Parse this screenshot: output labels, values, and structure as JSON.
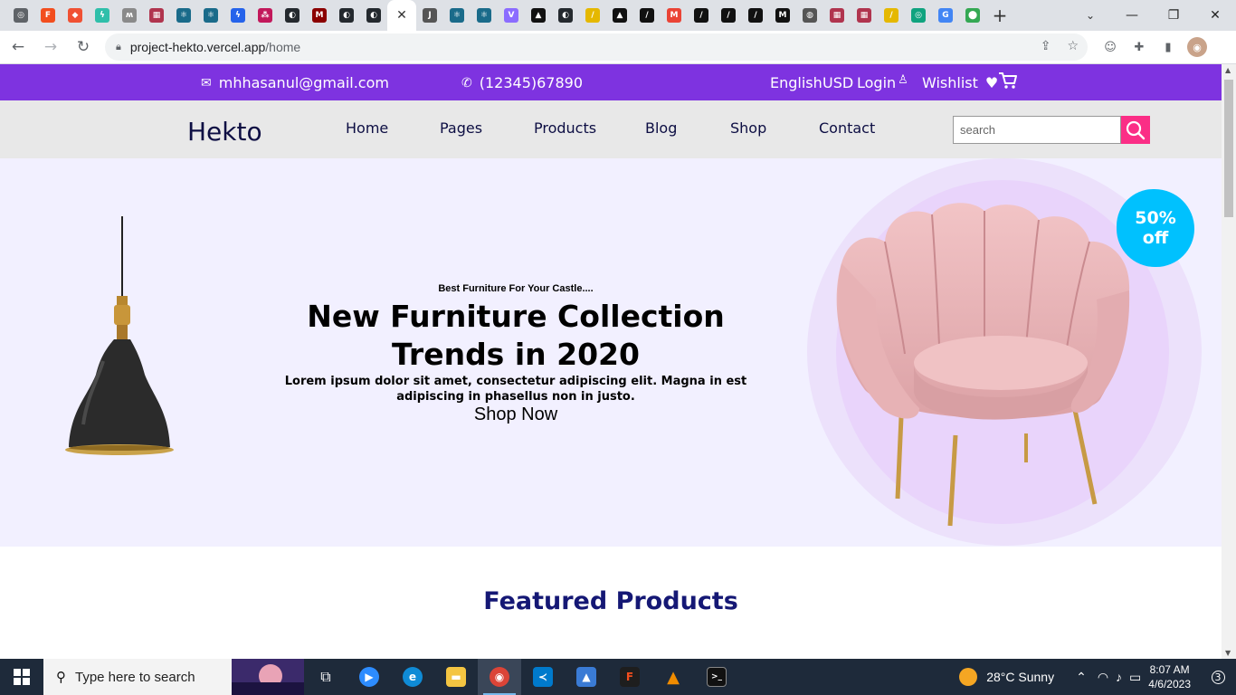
{
  "browser": {
    "tabs": [
      {
        "icon": "chrome-icon",
        "color": "#5f6368",
        "glyph": "◎"
      },
      {
        "icon": "figma-icon",
        "color": "#f24e1e",
        "glyph": "F"
      },
      {
        "icon": "git-icon",
        "color": "#f05133",
        "glyph": "◆"
      },
      {
        "icon": "bolt-icon",
        "color": "#2fbfaa",
        "glyph": "ϟ"
      },
      {
        "icon": "logo-icon",
        "color": "#8a8a8a",
        "glyph": "ʍ"
      },
      {
        "icon": "gift-icon",
        "color": "#b0344e",
        "glyph": "▦"
      },
      {
        "icon": "react-icon",
        "color": "#1a6b8a",
        "glyph": "⚛"
      },
      {
        "icon": "react-icon",
        "color": "#1a6b8a",
        "glyph": "⚛"
      },
      {
        "icon": "bolt-icon",
        "color": "#2563eb",
        "glyph": "ϟ"
      },
      {
        "icon": "dots-icon",
        "color": "#c2185b",
        "glyph": "⁂"
      },
      {
        "icon": "github-icon",
        "color": "#24292e",
        "glyph": "◐"
      },
      {
        "icon": "m-icon",
        "color": "#8b0000",
        "glyph": "M"
      },
      {
        "icon": "github-icon",
        "color": "#24292e",
        "glyph": "◐"
      },
      {
        "icon": "github-icon",
        "color": "#24292e",
        "glyph": "◐"
      }
    ],
    "active_tab_glyph": "✕",
    "tabs_right": [
      {
        "icon": "jadoo-icon",
        "color": "#555555",
        "glyph": "J"
      },
      {
        "icon": "react-icon",
        "color": "#1a6b8a",
        "glyph": "⚛"
      },
      {
        "icon": "react-icon",
        "color": "#1a6b8a",
        "glyph": "⚛"
      },
      {
        "icon": "vite-icon",
        "color": "#8b6cff",
        "glyph": "V"
      },
      {
        "icon": "triangle-icon",
        "color": "#111111",
        "glyph": "▲"
      },
      {
        "icon": "github-icon",
        "color": "#24292e",
        "glyph": "◐"
      },
      {
        "icon": "slash-icon",
        "color": "#e5b800",
        "glyph": "/"
      },
      {
        "icon": "triangle-icon",
        "color": "#111111",
        "glyph": "▲"
      },
      {
        "icon": "code-icon",
        "color": "#111111",
        "glyph": "/"
      },
      {
        "icon": "gmail-icon",
        "color": "#ea4335",
        "glyph": "M"
      },
      {
        "icon": "code-icon",
        "color": "#111111",
        "glyph": "/"
      },
      {
        "icon": "code-icon",
        "color": "#111111",
        "glyph": "/"
      },
      {
        "icon": "code-icon",
        "color": "#111111",
        "glyph": "/"
      },
      {
        "icon": "m-icon",
        "color": "#111111",
        "glyph": "M"
      },
      {
        "icon": "globe-icon",
        "color": "#555555",
        "glyph": "◍"
      },
      {
        "icon": "gift-icon",
        "color": "#b0344e",
        "glyph": "▦"
      },
      {
        "icon": "gift-icon",
        "color": "#b0344e",
        "glyph": "▦"
      },
      {
        "icon": "slash-icon",
        "color": "#e5b800",
        "glyph": "/"
      },
      {
        "icon": "chatgpt-icon",
        "color": "#10a37f",
        "glyph": "◎"
      },
      {
        "icon": "google-icon",
        "color": "#4285f4",
        "glyph": "G"
      },
      {
        "icon": "maps-icon",
        "color": "#34a853",
        "glyph": "⬤"
      }
    ],
    "newtab_glyph": "+",
    "url_host": "project-hekto.vercel.app",
    "url_path": "/home"
  },
  "topbar": {
    "email": "mhhasanul@gmail.com",
    "phone": "(12345)67890",
    "language": "English",
    "currency": "USD",
    "login": "Login",
    "wishlist": "Wishlist"
  },
  "header": {
    "logo": "Hekto",
    "nav": [
      "Home",
      "Pages",
      "Products",
      "Blog",
      "Shop",
      "Contact"
    ],
    "search_placeholder": "search"
  },
  "hero": {
    "tagline": "Best Furniture For Your Castle....",
    "title": "New Furniture Collection Trends in 2020",
    "description": "Lorem ipsum dolor sit amet, consectetur adipiscing elit. Magna in est adipiscing in phasellus non in justo.",
    "cta": "Shop Now",
    "badge_line1": "50%",
    "badge_line2": "off"
  },
  "sections": {
    "featured_title": "Featured Products"
  },
  "taskbar": {
    "search_placeholder": "Type here to search",
    "weather": "28°C  Sunny",
    "time": "8:07 AM",
    "date": "4/6/2023",
    "notifications": "3"
  },
  "colors": {
    "topbar": "#7e33e0",
    "accent_pink": "#fb2e86",
    "navy": "#0d0e43",
    "hero_bg": "#f2f0ff",
    "badge": "#00c1fe",
    "featured_title": "#151875"
  }
}
